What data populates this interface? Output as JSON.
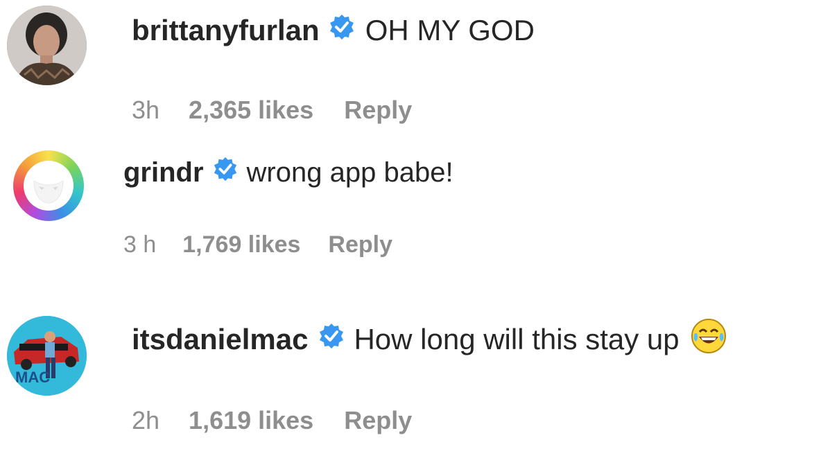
{
  "comments": [
    {
      "username": "brittanyfurlan",
      "text": "OH MY GOD",
      "time": "3h",
      "likes": "2,365 likes",
      "reply": "Reply",
      "verified": true,
      "avatar": "woman-portrait-avatar"
    },
    {
      "username": "grindr",
      "text": "wrong app babe!",
      "time": "3 h",
      "likes": "1,769 likes",
      "reply": "Reply",
      "verified": true,
      "avatar": "grindr-mask-logo"
    },
    {
      "username": "itsdanielmac",
      "text": "How long will this stay up",
      "emoji": "😂",
      "time": "2h",
      "likes": "1,619 likes",
      "reply": "Reply",
      "verified": true,
      "avatar": "man-on-red-car-avatar"
    }
  ],
  "colors": {
    "text": "#262626",
    "meta": "#8e8e8e",
    "verified": "#3897f0"
  }
}
